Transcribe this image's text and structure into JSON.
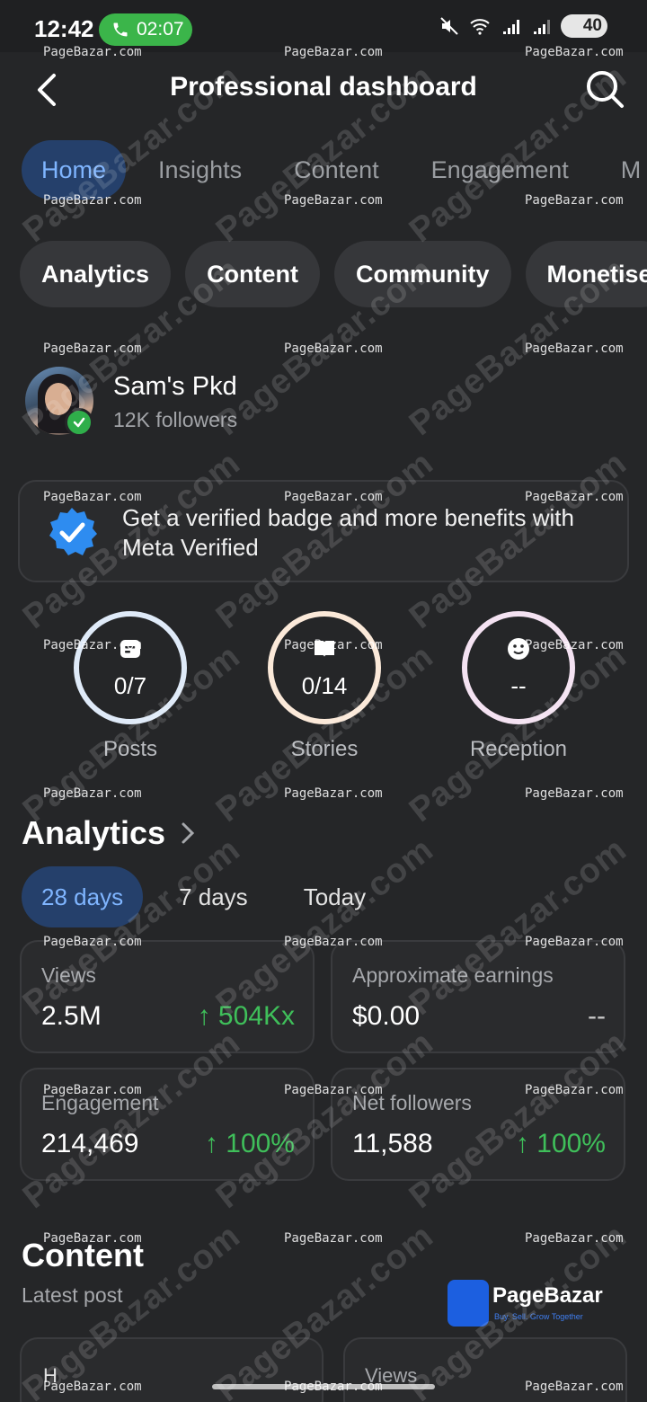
{
  "status_bar": {
    "time": "12:42",
    "call_duration": "02:07",
    "battery": "40",
    "icons": [
      "mute-icon",
      "wifi-icon",
      "signal-icon",
      "signal-icon"
    ]
  },
  "header": {
    "title": "Professional dashboard"
  },
  "tabs": [
    {
      "label": "Home",
      "active": true
    },
    {
      "label": "Insights",
      "active": false
    },
    {
      "label": "Content",
      "active": false
    },
    {
      "label": "Engagement",
      "active": false
    },
    {
      "label": "M",
      "active": false
    }
  ],
  "chips": [
    "Analytics",
    "Content",
    "Community",
    "Monetise"
  ],
  "profile": {
    "name": "Sam's Pkd",
    "followers": "12K followers"
  },
  "banner": {
    "text": "Get a verified badge and more benefits with Meta Verified"
  },
  "rings": [
    {
      "label": "Posts",
      "value": "0/7",
      "icon": "post-icon",
      "color": "#dfeaf8"
    },
    {
      "label": "Stories",
      "value": "0/14",
      "icon": "book-icon",
      "color": "#fbe9d9"
    },
    {
      "label": "Reception",
      "value": "--",
      "icon": "smile-icon",
      "color": "#f4e2f2"
    }
  ],
  "analytics": {
    "title": "Analytics",
    "ranges": [
      {
        "label": "28 days",
        "active": true
      },
      {
        "label": "7 days",
        "active": false
      },
      {
        "label": "Today",
        "active": false
      }
    ],
    "metrics": [
      {
        "label": "Views",
        "value": "2.5M",
        "change": "↑ 504Kx"
      },
      {
        "label": "Approximate earnings",
        "value": "$0.00",
        "change": "--"
      },
      {
        "label": "Engagement",
        "value": "214,469",
        "change": "↑ 100%"
      },
      {
        "label": "Net followers",
        "value": "11,588",
        "change": "↑ 100%"
      }
    ]
  },
  "content": {
    "title": "Content",
    "subtitle": "Latest post",
    "post_glyph": "H",
    "views_label": "Views"
  },
  "watermark": {
    "text": "PageBazar.com",
    "logo_name": "PageBazar",
    "logo_tagline": "Buy. Sell. Grow Together"
  },
  "colors": {
    "accent": "#7fb5ff",
    "accent_bg": "#25406b",
    "positive": "#3fbf5a",
    "background": "#252628"
  }
}
